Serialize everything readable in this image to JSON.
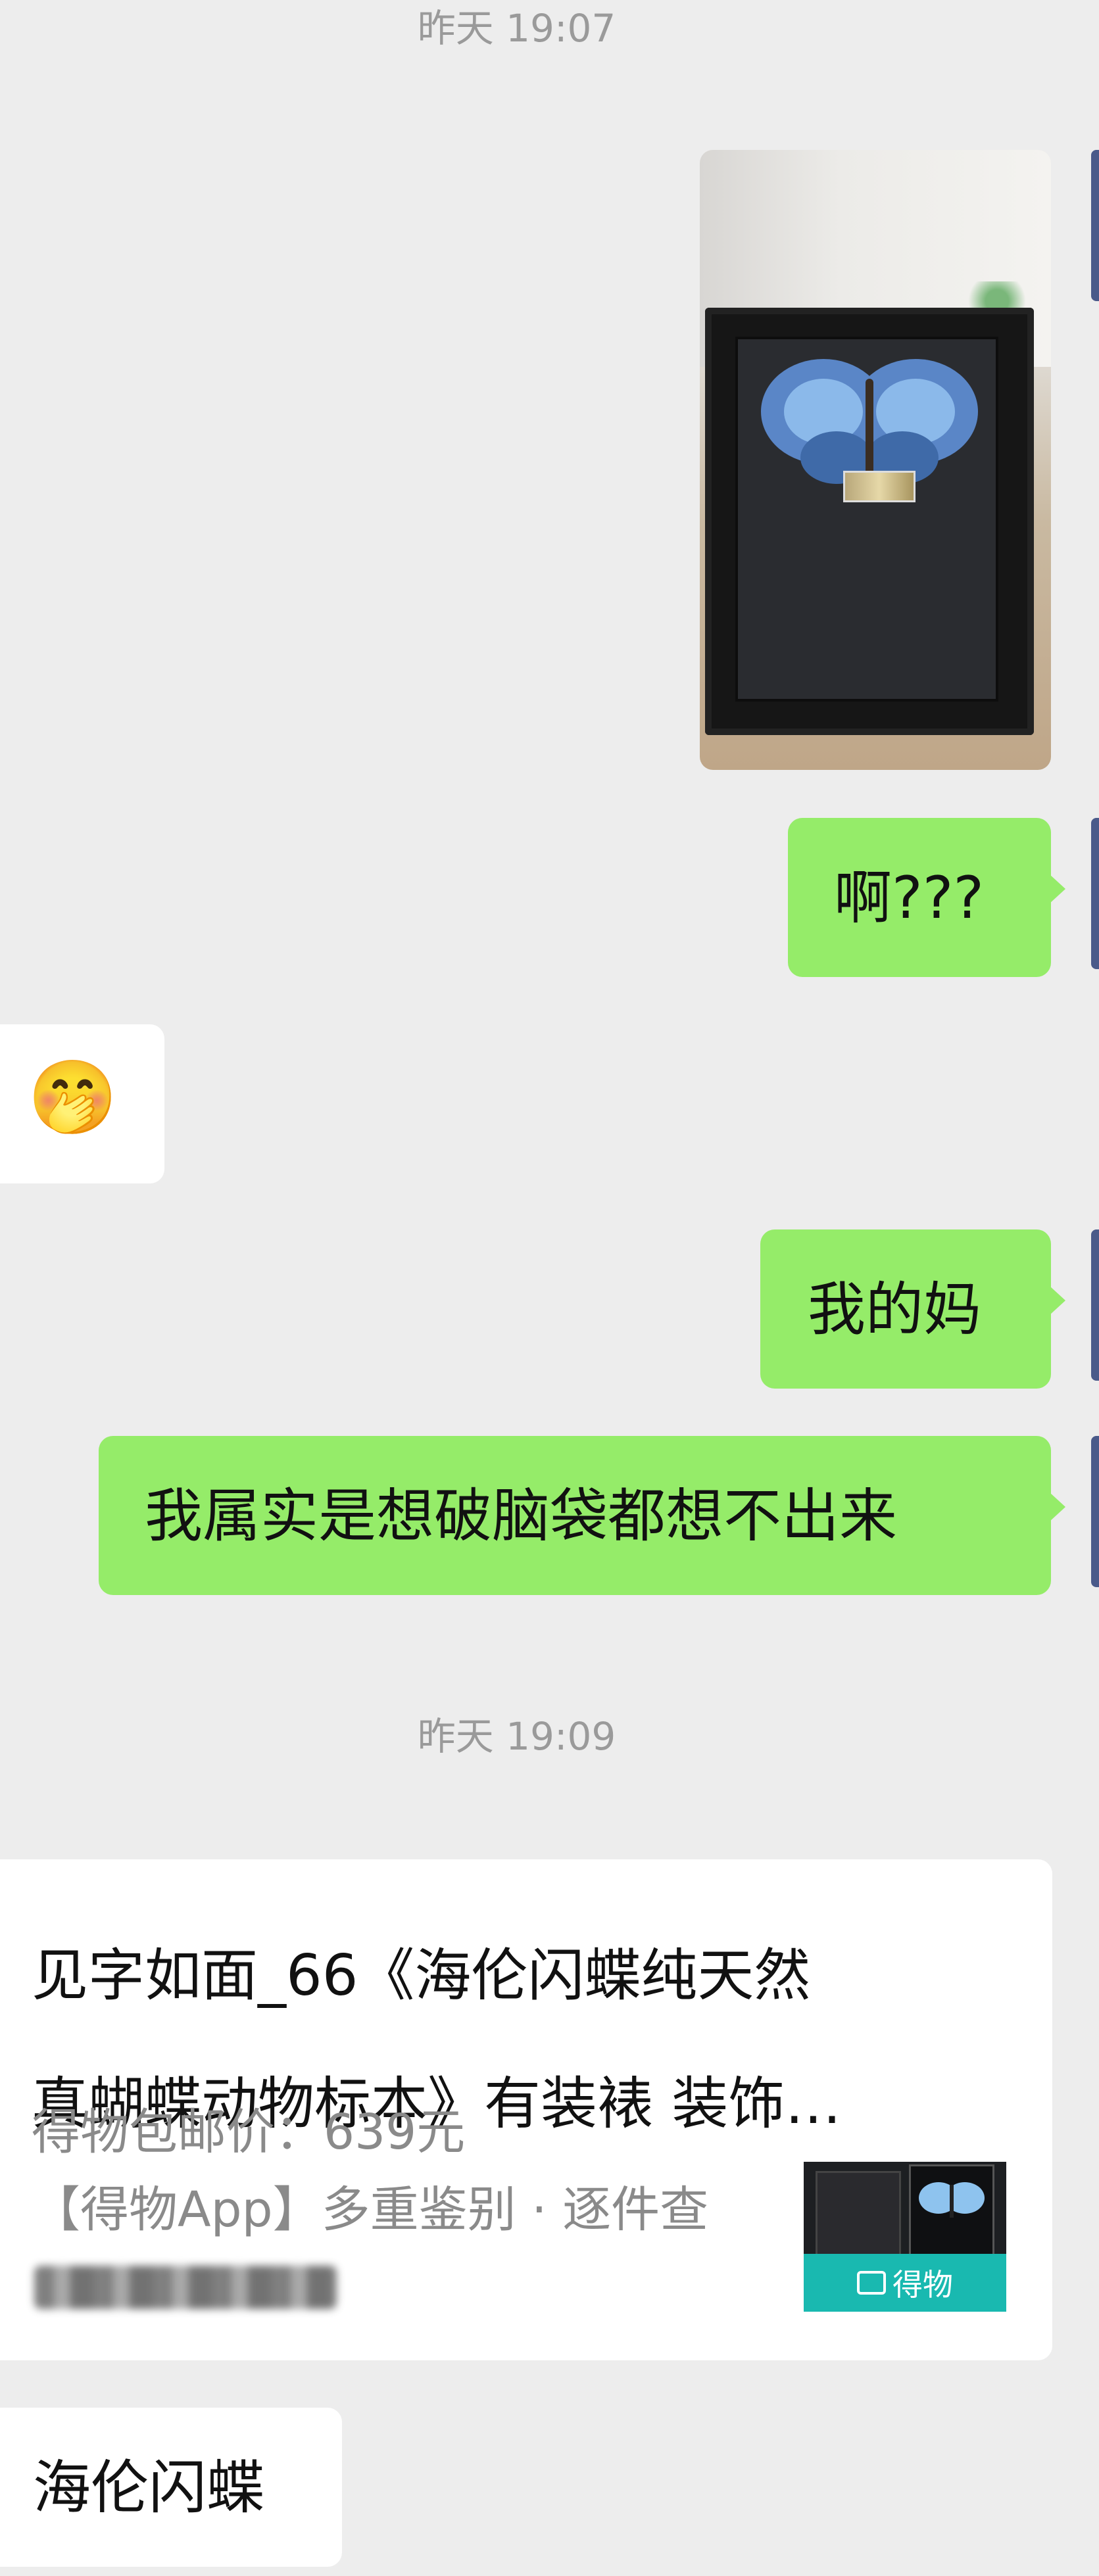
{
  "timestamps": {
    "first": "昨天 19:07",
    "second": "昨天 19:09"
  },
  "messages": {
    "ah": "啊???",
    "emoji": "🤭",
    "mom": "我的妈",
    "cant_think": "我属实是想破脑袋都想不出来",
    "name": "海伦闪蝶"
  },
  "link_card": {
    "title_line1": " 见字如面_66《海伦闪蝶纯天然",
    "title_line2": "真蝴蝶动物标本》有装裱 装饰…",
    "price": "得物包邮价：639元",
    "desc": "【得物App】多重鉴别 · 逐件查",
    "thumb_label": "得物",
    "accent": "#19b9b0"
  },
  "colors": {
    "outgoing_bubble": "#95ec69",
    "incoming_bubble": "#ffffff",
    "background": "#ededed"
  }
}
